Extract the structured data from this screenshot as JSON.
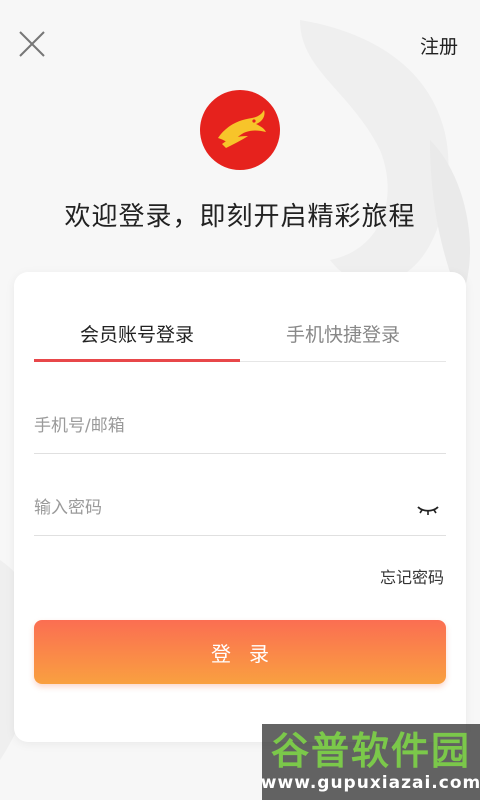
{
  "header": {
    "close_icon": "close-icon",
    "register_label": "注册"
  },
  "logo": {
    "icon": "dragon-logo-icon",
    "color": "#e6221d"
  },
  "welcome_text": "欢迎登录，即刻开启精彩旅程",
  "tabs": [
    {
      "label": "会员账号登录",
      "active": true
    },
    {
      "label": "手机快捷登录",
      "active": false
    }
  ],
  "form": {
    "account_placeholder": "手机号/邮箱",
    "account_value": "",
    "password_placeholder": "输入密码",
    "password_value": "",
    "eye_icon": "eye-closed-icon",
    "forgot_label": "忘记密码",
    "login_label": "登录"
  },
  "colors": {
    "accent": "#e8474a",
    "button_gradient_top": "#fb6e52",
    "button_gradient_bottom": "#f9a040"
  },
  "watermark": {
    "title": "谷普软件园",
    "url": "www.gupuxiazai.com"
  }
}
